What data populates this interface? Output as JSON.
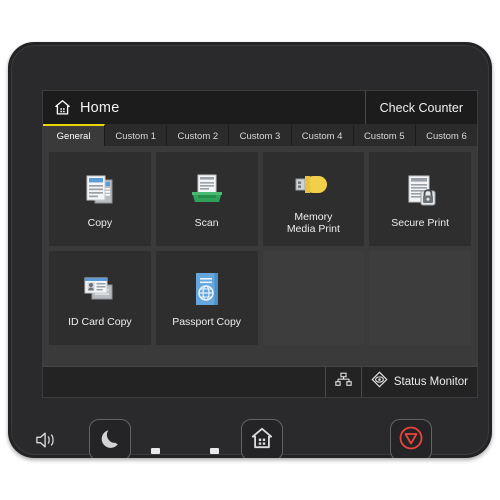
{
  "device": {
    "name": "printer-control-panel"
  },
  "screen": {
    "header": {
      "home_icon": "home-icon",
      "title": "Home",
      "check_counter_label": "Check Counter"
    },
    "tabs": [
      {
        "label": "General",
        "active": true
      },
      {
        "label": "Custom 1",
        "active": false
      },
      {
        "label": "Custom 2",
        "active": false
      },
      {
        "label": "Custom 3",
        "active": false
      },
      {
        "label": "Custom 4",
        "active": false
      },
      {
        "label": "Custom 5",
        "active": false
      },
      {
        "label": "Custom 6",
        "active": false
      }
    ],
    "tiles": [
      {
        "label": "Copy",
        "icon": "copy-documents-icon"
      },
      {
        "label": "Scan",
        "icon": "scanner-tray-icon"
      },
      {
        "label": "Memory\nMedia Print",
        "icon": "usb-drive-icon"
      },
      {
        "label": "Secure Print",
        "icon": "document-lock-icon"
      },
      {
        "label": "ID Card Copy",
        "icon": "id-card-icon"
      },
      {
        "label": "Passport Copy",
        "icon": "passport-booklet-icon"
      },
      {
        "label": "",
        "icon": ""
      },
      {
        "label": "",
        "icon": ""
      }
    ],
    "statusbar": {
      "network_icon": "network-icon",
      "status_monitor_icon": "status-monitor-icon",
      "status_monitor_label": "Status Monitor"
    }
  },
  "hardware": {
    "speaker_icon": "speaker-icon",
    "sleep_button": "sleep-moon-icon",
    "home_button": "home-icon",
    "stop_button": "stop-icon",
    "data_led": "data-indicator-icon",
    "error_led": "error-indicator-icon"
  },
  "colors": {
    "accent_yellow": "#e8d400",
    "stop_red": "#e8453c",
    "scan_green": "#2fa158",
    "doc_blue": "#5b9bd5",
    "usb_yellow": "#f2cf4a",
    "passport_blue": "#64a6dd"
  }
}
